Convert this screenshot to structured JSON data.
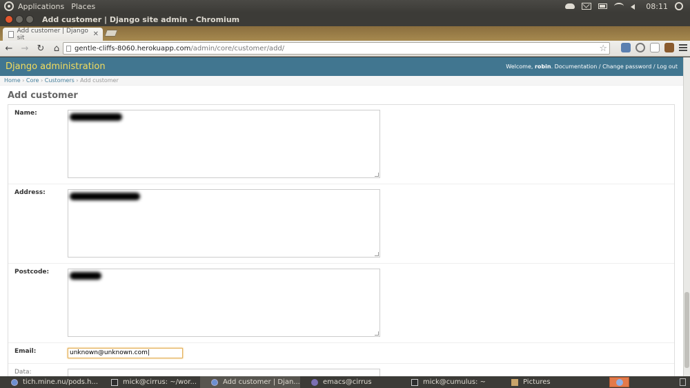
{
  "top_panel": {
    "menu_applications": "Applications",
    "menu_places": "Places",
    "clock": "08:11"
  },
  "window": {
    "title": "Add customer | Django site admin - Chromium"
  },
  "browser": {
    "tab_title": "Add customer | Django sit",
    "url_host": "gentle-cliffs-8060.herokuapp.com",
    "url_path": "/admin/core/customer/add/"
  },
  "django": {
    "branding": "Django administration",
    "welcome": "Welcome,",
    "username": "robin",
    "links_text": ". Documentation / Change password / Log out",
    "breadcrumbs": {
      "home": "Home",
      "core": "Core",
      "customers": "Customers",
      "current": "Add customer",
      "sep": " › "
    },
    "page_title": "Add customer",
    "fields": {
      "name_label": "Name:",
      "address_label": "Address:",
      "postcode_label": "Postcode:",
      "email_label": "Email:",
      "email_value": "unknown@unknown.com",
      "data_label": "Data:"
    }
  },
  "taskbar": {
    "items": [
      "tich.mine.nu/pods.h...",
      "mick@cirrus: ~/wor...",
      "Add customer | Djan...",
      "emacs@cirrus",
      "mick@cumulus: ~",
      "Pictures"
    ]
  }
}
